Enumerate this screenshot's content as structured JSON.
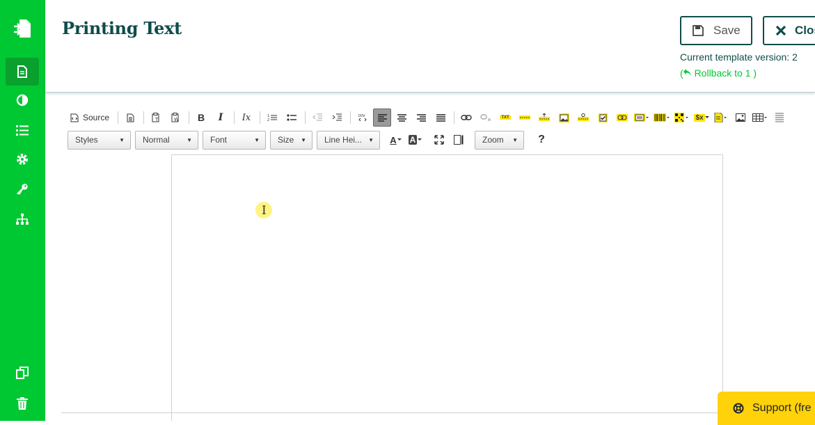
{
  "sidebar": {
    "logo_icon": "document-export-icon",
    "items": [
      {
        "icon": "document-icon",
        "active": true
      },
      {
        "icon": "contrast-icon",
        "active": false
      },
      {
        "icon": "list-icon",
        "active": false
      },
      {
        "icon": "gear-icon",
        "active": false
      },
      {
        "icon": "key-icon",
        "active": false
      },
      {
        "icon": "sitemap-icon",
        "active": false
      }
    ],
    "bottom_items": [
      {
        "icon": "copy-icon"
      },
      {
        "icon": "trash-icon"
      }
    ],
    "color": "#00c832"
  },
  "header": {
    "title": "Printing Text",
    "save_label": "Save",
    "close_label": "Clos",
    "version_text": "Current template version: 2",
    "rollback_open": "(",
    "rollback_label": "Rollback to 1",
    "rollback_close": ")"
  },
  "toolbar": {
    "source_label": "Source",
    "styles_label": "Styles",
    "format_label": "Normal",
    "font_label": "Font",
    "size_label": "Size",
    "line_height_label": "Line Hei...",
    "zoom_label": "Zoom",
    "help_label": "?",
    "bold_label": "B",
    "italic_label": "I",
    "clear_format_label": "Ix",
    "text_color_label": "A",
    "bg_color_label": "A",
    "field_label": "$x",
    "txt_label": "TXT"
  },
  "support": {
    "label": "Support (fre"
  },
  "colors": {
    "brand_green": "#00c832",
    "dark_teal": "#0f4c4a",
    "support_yellow": "#ffd20a"
  }
}
